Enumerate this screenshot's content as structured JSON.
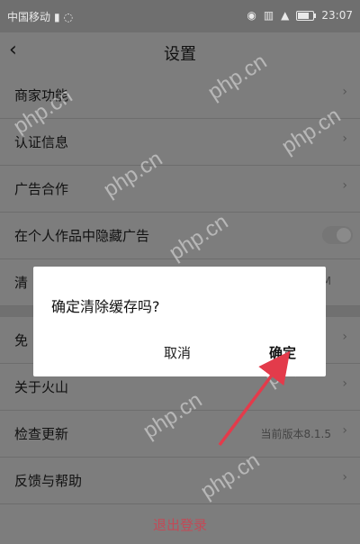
{
  "status_bar": {
    "carrier": "中国移动",
    "signal_icon": "signal-icon",
    "wifi_icon": "wifi-icon",
    "eye_icon": "eye-icon",
    "vibrate_icon": "vibrate-icon",
    "time": "23:07"
  },
  "nav": {
    "title": "设置",
    "back_icon": "back-chevron-icon"
  },
  "rows": [
    {
      "label": "商家功能",
      "chevron": "›"
    },
    {
      "label": "认证信息",
      "chevron": "›"
    },
    {
      "label": "广告合作",
      "chevron": "›"
    },
    {
      "label": "在个人作品中隐藏广告"
    },
    {
      "label": "清",
      "meta": "M"
    },
    {
      "label": "免",
      "chevron": "›"
    },
    {
      "label": "关于火山",
      "chevron": "›"
    },
    {
      "label": "检查更新",
      "meta": "当前版本8.1.5",
      "chevron": "›"
    },
    {
      "label": "反馈与帮助",
      "chevron": "›"
    }
  ],
  "logout_label": "退出登录",
  "dialog": {
    "title": "确定清除缓存吗?",
    "cancel": "取消",
    "confirm": "确定"
  },
  "watermark": "php.cn",
  "colors": {
    "overlay_gray": "#7d7d7d",
    "dialog_bg": "#ffffff",
    "logout_text": "#c24a57",
    "annotation_arrow": "#e33b4b"
  }
}
